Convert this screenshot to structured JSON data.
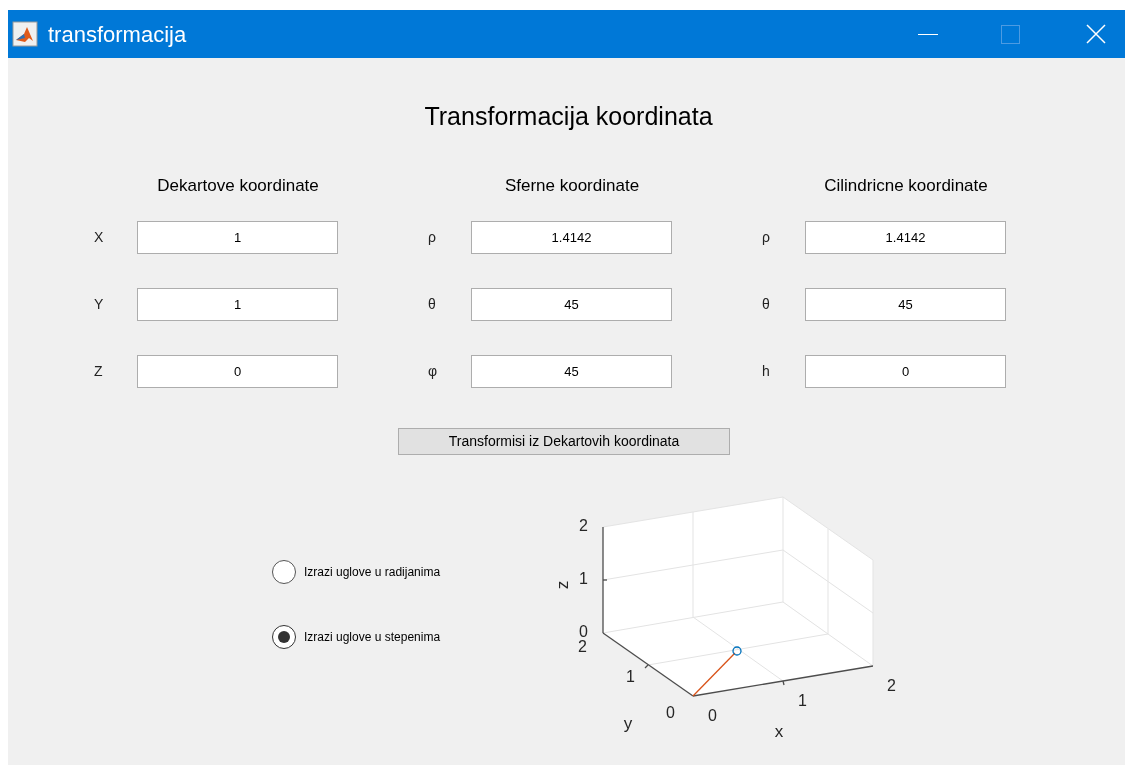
{
  "window": {
    "title": "transformacija"
  },
  "heading": "Transformacija koordinata",
  "groups": [
    {
      "title": "Dekartove koordinate",
      "fields": [
        {
          "label": "X",
          "value": "1"
        },
        {
          "label": "Y",
          "value": "1"
        },
        {
          "label": "Z",
          "value": "0"
        }
      ]
    },
    {
      "title": "Sferne koordinate",
      "fields": [
        {
          "label": "ρ",
          "value": "1.4142"
        },
        {
          "label": "θ",
          "value": "45"
        },
        {
          "label": "φ",
          "value": "45"
        }
      ]
    },
    {
      "title": "Cilindricne koordinate",
      "fields": [
        {
          "label": "ρ",
          "value": "1.4142"
        },
        {
          "label": "θ",
          "value": "45"
        },
        {
          "label": "h",
          "value": "0"
        }
      ]
    }
  ],
  "button": "Transformisi iz Dekartovih koordinata",
  "angle_units": [
    {
      "label": "Izrazi uglove u radijanima",
      "selected": false
    },
    {
      "label": "Izrazi uglove u stepenima",
      "selected": true
    }
  ],
  "plot": {
    "xlabel": "x",
    "ylabel": "y",
    "zlabel": "z",
    "xticks": [
      "0",
      "1",
      "2"
    ],
    "yticks": [
      "0",
      "1",
      "2"
    ],
    "zticks": [
      "2",
      "1",
      "0"
    ]
  }
}
